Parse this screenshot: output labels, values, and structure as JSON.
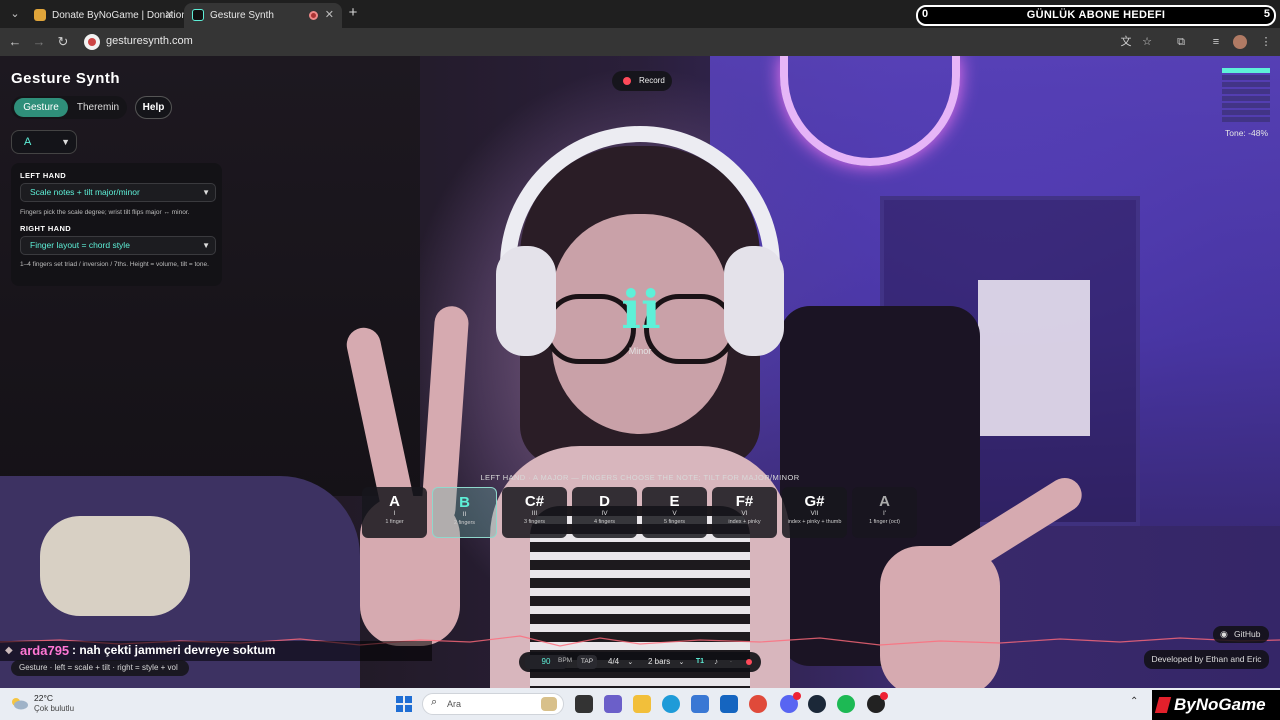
{
  "browser": {
    "tabs": [
      {
        "title": "Donate ByNoGame | Donations",
        "active": false
      },
      {
        "title": "Gesture Synth",
        "active": true
      }
    ],
    "url": "gesturesynth.com"
  },
  "stream_overlay": {
    "goal_current": "0",
    "goal_title": "GÜNLÜK ABONE HEDEFI",
    "goal_target": "5",
    "chat_user": "arda795",
    "chat_message": ": nah çekti jammeri devreye soktum",
    "brand": "ByNoGame"
  },
  "app": {
    "title": "Gesture Synth",
    "modes": [
      "Gesture",
      "Theremin"
    ],
    "active_mode": "Gesture",
    "help_label": "Help",
    "key": "A",
    "record_label": "Record",
    "tone_label": "Tone: -48%",
    "tone_level": 0.14,
    "left_hand": {
      "heading": "LEFT HAND",
      "mode": "Scale notes + tilt major/minor",
      "note": "Fingers pick the scale degree; wrist tilt flips major ↔ minor."
    },
    "right_hand": {
      "heading": "RIGHT HAND",
      "mode": "Finger layout = chord style",
      "note": "1–4 fingers set triad / inversion / 7ths. Height = volume, tilt = tone."
    },
    "current_degree": "ii",
    "current_quality": "Minor",
    "hint": "LEFT HAND · A MAJOR — FINGERS CHOOSE THE NOTE; TILT FOR MAJOR/MINOR",
    "notes": [
      {
        "name": "A",
        "degree": "I",
        "fingers": "1 finger",
        "state": "normal"
      },
      {
        "name": "B",
        "degree": "II",
        "fingers": "2 fingers",
        "state": "active"
      },
      {
        "name": "C#",
        "degree": "III",
        "fingers": "3 fingers",
        "state": "normal"
      },
      {
        "name": "D",
        "degree": "IV",
        "fingers": "4 fingers",
        "state": "normal"
      },
      {
        "name": "E",
        "degree": "V",
        "fingers": "5 fingers",
        "state": "normal"
      },
      {
        "name": "F#",
        "degree": "VI",
        "fingers": "index + pinky",
        "state": "normal"
      },
      {
        "name": "G#",
        "degree": "VII",
        "fingers": "index + pinky + thumb",
        "state": "normal"
      },
      {
        "name": "A",
        "degree": "I'",
        "fingers": "1 finger (oct)",
        "state": "dim"
      }
    ],
    "status": "Gesture · left = scale + tilt · right = style + vol",
    "transport": {
      "bpm": "90",
      "bpm_label": "BPM",
      "tap_label": "TAP",
      "time_signature": "4/4",
      "loop_length": "2 bars",
      "t1_label": "T1"
    },
    "github_label": "GitHub",
    "credit": "Developed by Ethan and Eric"
  },
  "taskbar": {
    "temperature": "22°C",
    "condition": "Çok bulutlu",
    "search_placeholder": "Ara"
  },
  "colors": {
    "accent": "#5ef0d8",
    "record": "#ff4a5a",
    "chat_user": "#ff77d5"
  }
}
